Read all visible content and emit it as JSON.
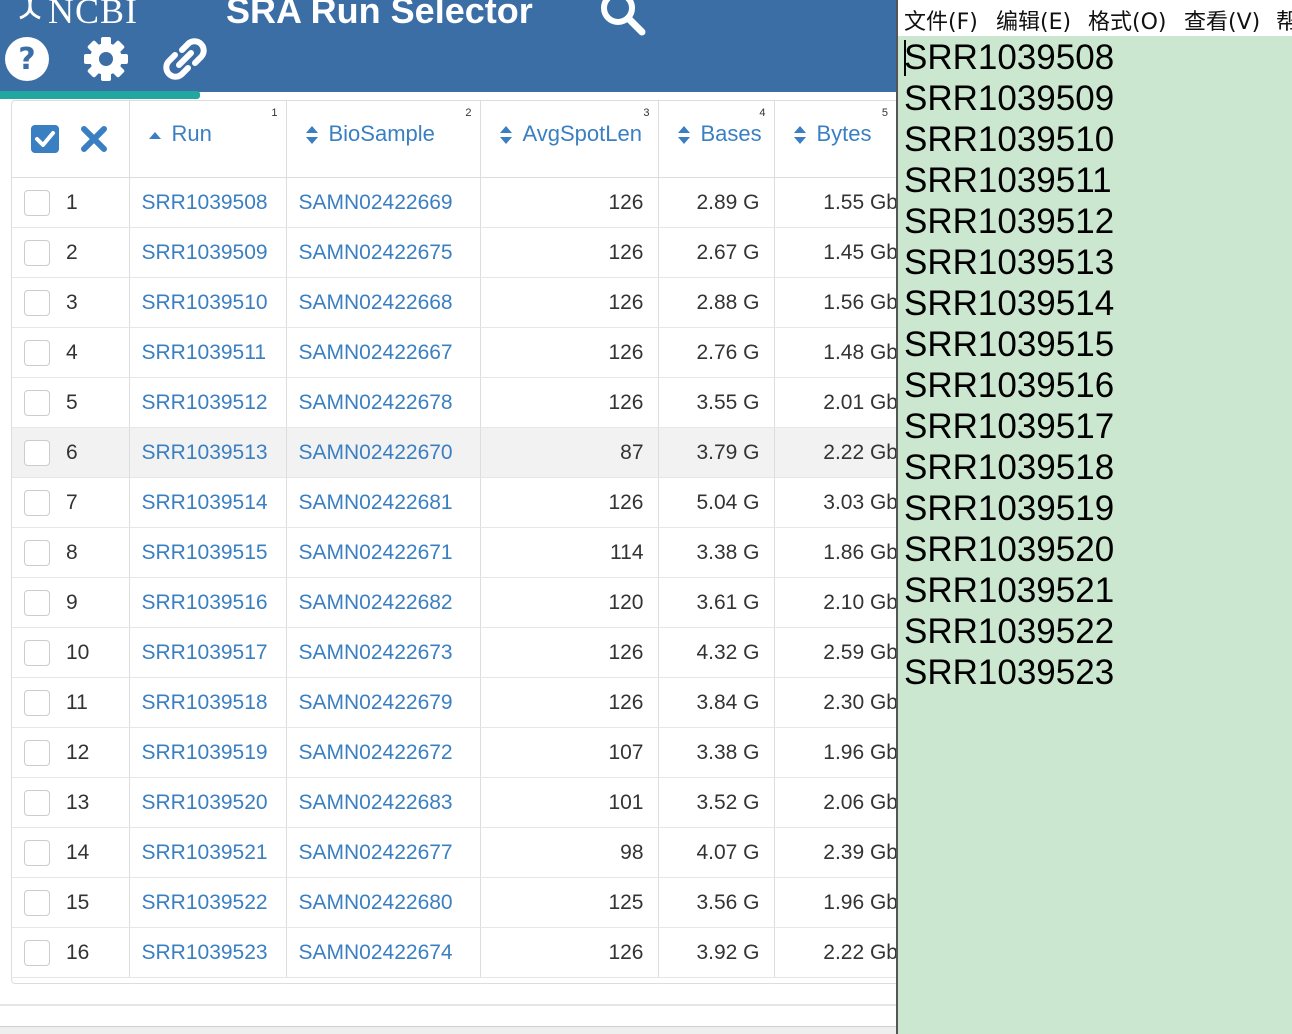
{
  "app": {
    "logo_text": "NCBI",
    "title": "SRA Run Selector",
    "icons": [
      "search-icon",
      "help-icon",
      "gear-icon",
      "link-icon"
    ],
    "colors": {
      "header_bg": "#3a6ea5",
      "accent": "#1fa7a0",
      "link": "#3a7fc2",
      "notepad_bg": "#cce7cf"
    }
  },
  "table": {
    "select_all_icon": "checked-checkbox-icon",
    "clear_icon": "x-icon",
    "headers": [
      {
        "label": "Run",
        "index": "1",
        "sort_icon": "sort-asc-icon"
      },
      {
        "label": "BioSample",
        "index": "2",
        "sort_icon": "sort-both-icon"
      },
      {
        "label": "AvgSpotLen",
        "index": "3",
        "sort_icon": "sort-both-icon"
      },
      {
        "label": "Bases",
        "index": "4",
        "sort_icon": "sort-both-icon"
      },
      {
        "label": "Bytes",
        "index": "5",
        "sort_icon": "sort-both-icon"
      }
    ],
    "rows": [
      {
        "n": "1",
        "run": "SRR1039508",
        "biosample": "SAMN02422669",
        "avgspotlen": "126",
        "bases": "2.89 G",
        "bytes": "1.55 Gb"
      },
      {
        "n": "2",
        "run": "SRR1039509",
        "biosample": "SAMN02422675",
        "avgspotlen": "126",
        "bases": "2.67 G",
        "bytes": "1.45 Gb"
      },
      {
        "n": "3",
        "run": "SRR1039510",
        "biosample": "SAMN02422668",
        "avgspotlen": "126",
        "bases": "2.88 G",
        "bytes": "1.56 Gb"
      },
      {
        "n": "4",
        "run": "SRR1039511",
        "biosample": "SAMN02422667",
        "avgspotlen": "126",
        "bases": "2.76 G",
        "bytes": "1.48 Gb"
      },
      {
        "n": "5",
        "run": "SRR1039512",
        "biosample": "SAMN02422678",
        "avgspotlen": "126",
        "bases": "3.55 G",
        "bytes": "2.01 Gb"
      },
      {
        "n": "6",
        "run": "SRR1039513",
        "biosample": "SAMN02422670",
        "avgspotlen": "87",
        "bases": "3.79 G",
        "bytes": "2.22 Gb"
      },
      {
        "n": "7",
        "run": "SRR1039514",
        "biosample": "SAMN02422681",
        "avgspotlen": "126",
        "bases": "5.04 G",
        "bytes": "3.03 Gb"
      },
      {
        "n": "8",
        "run": "SRR1039515",
        "biosample": "SAMN02422671",
        "avgspotlen": "114",
        "bases": "3.38 G",
        "bytes": "1.86 Gb"
      },
      {
        "n": "9",
        "run": "SRR1039516",
        "biosample": "SAMN02422682",
        "avgspotlen": "120",
        "bases": "3.61 G",
        "bytes": "2.10 Gb"
      },
      {
        "n": "10",
        "run": "SRR1039517",
        "biosample": "SAMN02422673",
        "avgspotlen": "126",
        "bases": "4.32 G",
        "bytes": "2.59 Gb"
      },
      {
        "n": "11",
        "run": "SRR1039518",
        "biosample": "SAMN02422679",
        "avgspotlen": "126",
        "bases": "3.84 G",
        "bytes": "2.30 Gb"
      },
      {
        "n": "12",
        "run": "SRR1039519",
        "biosample": "SAMN02422672",
        "avgspotlen": "107",
        "bases": "3.38 G",
        "bytes": "1.96 Gb"
      },
      {
        "n": "13",
        "run": "SRR1039520",
        "biosample": "SAMN02422683",
        "avgspotlen": "101",
        "bases": "3.52 G",
        "bytes": "2.06 Gb"
      },
      {
        "n": "14",
        "run": "SRR1039521",
        "biosample": "SAMN02422677",
        "avgspotlen": "98",
        "bases": "4.07 G",
        "bytes": "2.39 Gb"
      },
      {
        "n": "15",
        "run": "SRR1039522",
        "biosample": "SAMN02422680",
        "avgspotlen": "125",
        "bases": "3.56 G",
        "bytes": "1.96 Gb"
      },
      {
        "n": "16",
        "run": "SRR1039523",
        "biosample": "SAMN02422674",
        "avgspotlen": "126",
        "bases": "3.92 G",
        "bytes": "2.22 Gb"
      }
    ]
  },
  "notepad": {
    "menu": [
      "文件(F)",
      "编辑(E)",
      "格式(O)",
      "查看(V)",
      "帮"
    ],
    "lines": [
      "SRR1039508",
      "SRR1039509",
      "SRR1039510",
      "SRR1039511",
      "SRR1039512",
      "SRR1039513",
      "SRR1039514",
      "SRR1039515",
      "SRR1039516",
      "SRR1039517",
      "SRR1039518",
      "SRR1039519",
      "SRR1039520",
      "SRR1039521",
      "SRR1039522",
      "SRR1039523"
    ]
  }
}
